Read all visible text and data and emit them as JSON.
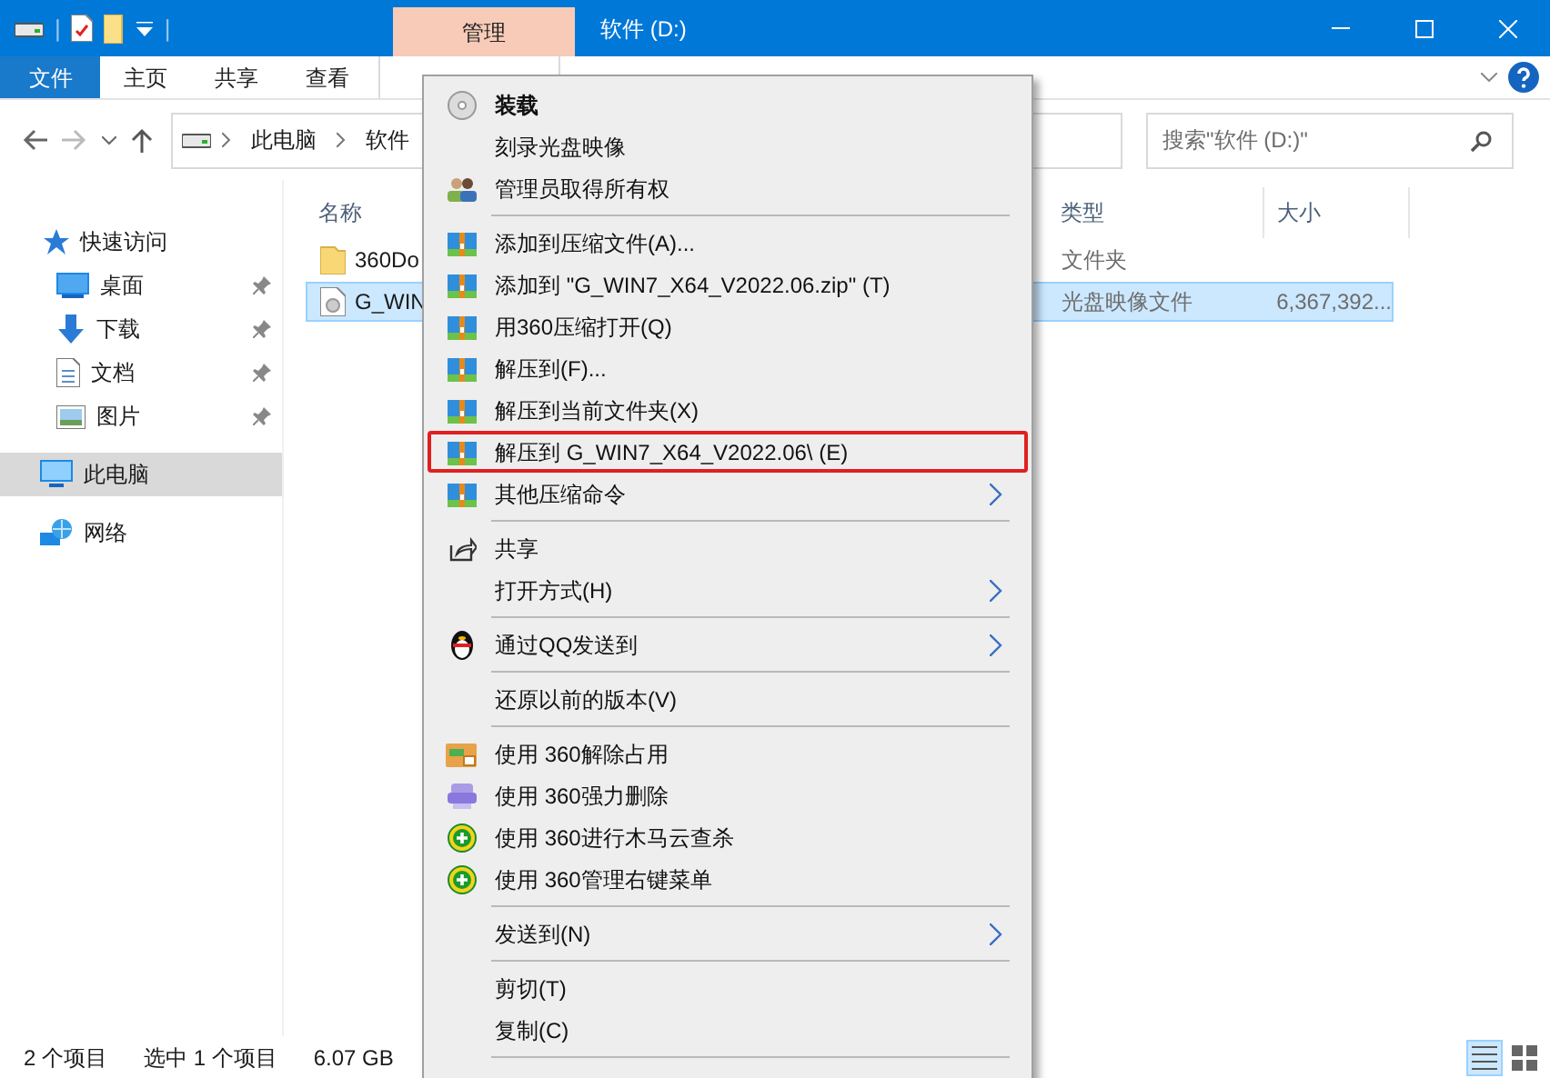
{
  "title_bar": {
    "quick_access_separator": "|",
    "contextual_tab": "管理",
    "title": "软件 (D:)"
  },
  "ribbon": {
    "tabs": [
      {
        "label": "文件",
        "selected": true
      },
      {
        "label": "主页",
        "selected": false
      },
      {
        "label": "共享",
        "selected": false
      },
      {
        "label": "查看",
        "selected": false
      }
    ]
  },
  "address_bar": {
    "path": [
      "此电脑",
      "软件"
    ],
    "search": {
      "placeholder": "搜索\"软件 (D:)\""
    }
  },
  "sidebar": {
    "items": [
      {
        "label": "快速访问",
        "kind": "star",
        "pinned": false,
        "selected": false
      },
      {
        "label": "桌面",
        "kind": "desktop",
        "pinned": true,
        "selected": false
      },
      {
        "label": "下载",
        "kind": "download",
        "pinned": true,
        "selected": false
      },
      {
        "label": "文档",
        "kind": "document",
        "pinned": true,
        "selected": false
      },
      {
        "label": "图片",
        "kind": "pictures",
        "pinned": true,
        "selected": false
      },
      {
        "label": "此电脑",
        "kind": "computer",
        "pinned": false,
        "selected": true
      },
      {
        "label": "网络",
        "kind": "network",
        "pinned": false,
        "selected": false
      }
    ]
  },
  "file_list": {
    "columns": [
      "名称",
      "类型",
      "大小"
    ],
    "rows": [
      {
        "name": "360Do",
        "kind": "folder",
        "type": "文件夹",
        "size": "",
        "selected": false
      },
      {
        "name": "G_WIN",
        "kind": "disc-image",
        "type": "光盘映像文件",
        "size": "6,367,392...",
        "selected": true
      }
    ]
  },
  "context_menu": {
    "items": [
      {
        "label": "装载",
        "kind": "disc",
        "default": true
      },
      {
        "label": "刻录光盘映像",
        "kind": "plain"
      },
      {
        "label": "管理员取得所有权",
        "kind": "admin"
      },
      {
        "kind": "separator"
      },
      {
        "label": "添加到压缩文件(A)...",
        "kind": "archive"
      },
      {
        "label": "添加到 \"G_WIN7_X64_V2022.06.zip\" (T)",
        "kind": "archive"
      },
      {
        "label": "用360压缩打开(Q)",
        "kind": "archive"
      },
      {
        "label": "解压到(F)...",
        "kind": "archive"
      },
      {
        "label": "解压到当前文件夹(X)",
        "kind": "archive"
      },
      {
        "label": "解压到 G_WIN7_X64_V2022.06\\ (E)",
        "kind": "archive",
        "annotated": true
      },
      {
        "label": "其他压缩命令",
        "kind": "archive",
        "submenu": true
      },
      {
        "kind": "separator"
      },
      {
        "label": "共享",
        "kind": "share"
      },
      {
        "label": "打开方式(H)",
        "kind": "plain",
        "submenu": true
      },
      {
        "kind": "separator"
      },
      {
        "label": "通过QQ发送到",
        "kind": "penguin",
        "submenu": true
      },
      {
        "kind": "separator"
      },
      {
        "label": "还原以前的版本(V)",
        "kind": "plain"
      },
      {
        "kind": "separator"
      },
      {
        "label": "使用 360解除占用",
        "kind": "unlock"
      },
      {
        "label": "使用 360强力删除",
        "kind": "shred"
      },
      {
        "label": "使用 360进行木马云查杀",
        "kind": "shield"
      },
      {
        "label": "使用 360管理右键菜单",
        "kind": "shield"
      },
      {
        "kind": "separator"
      },
      {
        "label": "发送到(N)",
        "kind": "plain",
        "submenu": true
      },
      {
        "kind": "separator"
      },
      {
        "label": "剪切(T)",
        "kind": "plain"
      },
      {
        "label": "复制(C)",
        "kind": "plain"
      },
      {
        "kind": "separator"
      }
    ]
  },
  "status_bar": {
    "item_count": "2 个项目",
    "selection": "选中 1 个项目",
    "selection_size": "6.07 GB",
    "views": [
      {
        "kind": "details",
        "selected": true
      },
      {
        "kind": "large-icons",
        "selected": false
      }
    ]
  }
}
